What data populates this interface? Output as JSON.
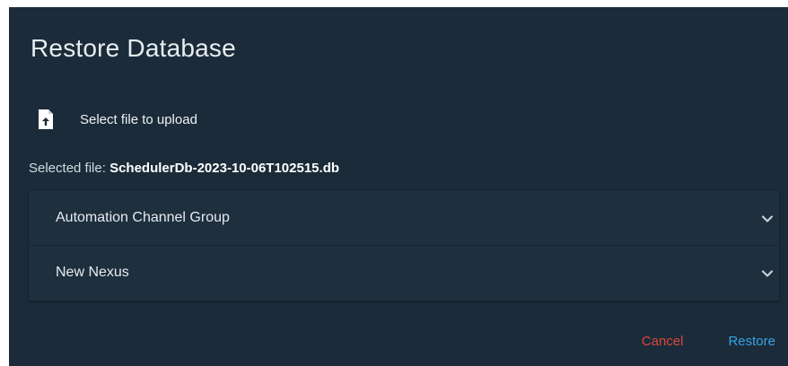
{
  "dialog": {
    "title": "Restore Database",
    "upload": {
      "label": "Select file to upload",
      "icon": "file-upload-icon"
    },
    "selected_file": {
      "prefix": "Selected file: ",
      "filename": "SchedulerDb-2023-10-06T102515.db"
    },
    "panels": [
      {
        "label": "Automation Channel Group",
        "expanded": false
      },
      {
        "label": "New Nexus",
        "expanded": false
      }
    ],
    "actions": {
      "cancel_label": "Cancel",
      "restore_label": "Restore"
    }
  },
  "colors": {
    "dialog_bg": "#1b2b39",
    "cancel": "#d9473b",
    "restore": "#36a3e6",
    "text": "#e8edf1"
  }
}
